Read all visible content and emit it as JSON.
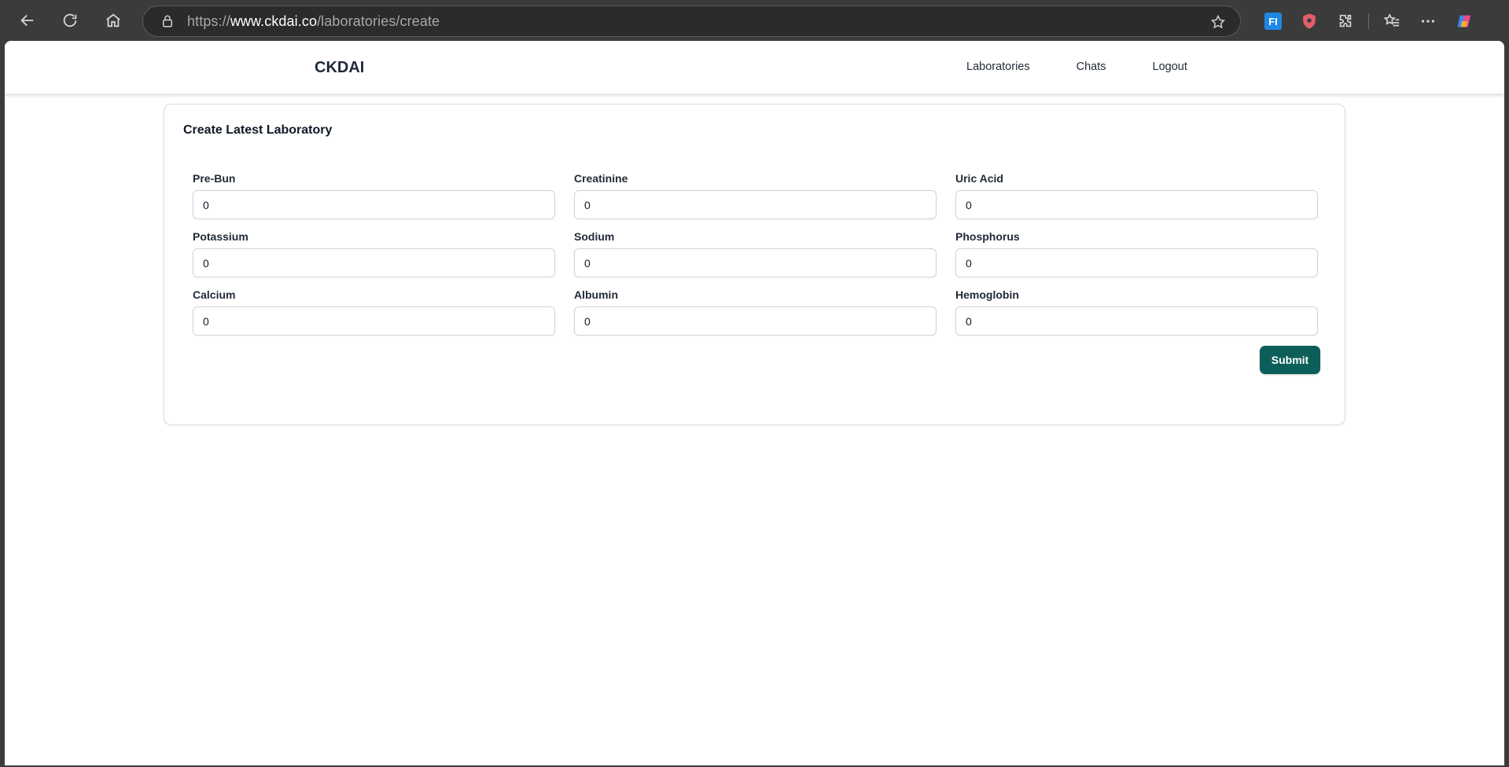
{
  "browser": {
    "url_scheme": "https://",
    "url_host": "www.ckdai.co",
    "url_path": "/laboratories/create",
    "extension_badge": "FI"
  },
  "header": {
    "brand": "CKDAI",
    "nav": [
      "Laboratories",
      "Chats",
      "Logout"
    ]
  },
  "form": {
    "title": "Create Latest Laboratory",
    "fields": [
      {
        "label": "Pre-Bun",
        "value": "0"
      },
      {
        "label": "Creatinine",
        "value": "0"
      },
      {
        "label": "Uric Acid",
        "value": "0"
      },
      {
        "label": "Potassium",
        "value": "0"
      },
      {
        "label": "Sodium",
        "value": "0"
      },
      {
        "label": "Phosphorus",
        "value": "0"
      },
      {
        "label": "Calcium",
        "value": "0"
      },
      {
        "label": "Albumin",
        "value": "0"
      },
      {
        "label": "Hemoglobin",
        "value": "0"
      }
    ],
    "submit_label": "Submit"
  },
  "colors": {
    "accent": "#0c5f58",
    "chrome": "#3b3b3b"
  }
}
